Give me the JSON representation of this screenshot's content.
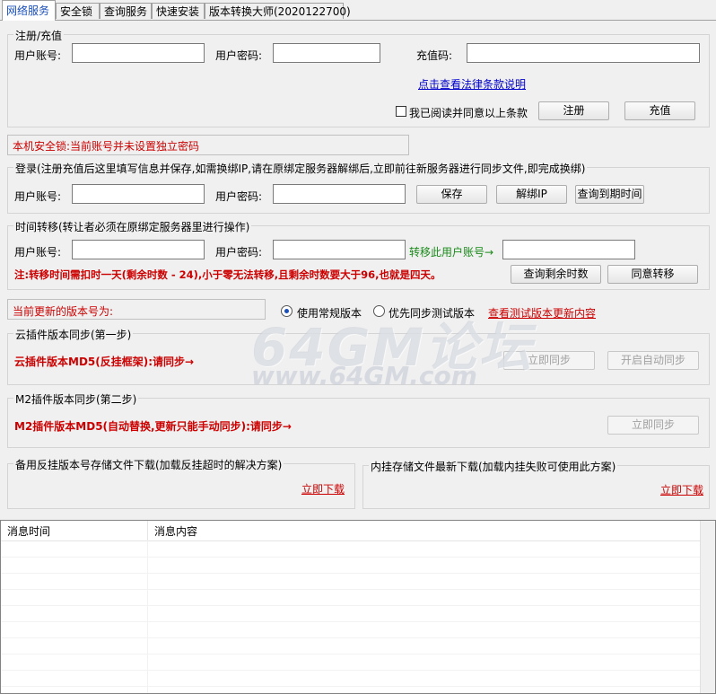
{
  "tabs": [
    {
      "label": "网络服务",
      "active": true
    },
    {
      "label": "安全锁",
      "active": false
    },
    {
      "label": "查询服务",
      "active": false
    },
    {
      "label": "快速安装",
      "active": false
    },
    {
      "label": "版本转换大师(2020122700)",
      "active": false
    }
  ],
  "register": {
    "title": "注册/充值",
    "account_label": "用户账号:",
    "password_label": "用户密码:",
    "recharge_code_label": "充值码:",
    "account_value": "",
    "password_value": "",
    "recharge_code_value": "",
    "legal_link": "点击查看法律条款说明",
    "agree_label": "我已阅读并同意以上条款",
    "agree_checked": false,
    "register_button": "注册",
    "recharge_button": "充值"
  },
  "security_lock_status": "本机安全锁:当前账号并未设置独立密码",
  "login": {
    "title": "登录(注册充值后这里填写信息并保存,如需换绑IP,请在原绑定服务器解绑后,立即前往新服务器进行同步文件,即完成换绑)",
    "account_label": "用户账号:",
    "password_label": "用户密码:",
    "account_value": "",
    "password_value": "",
    "save_button": "保存",
    "unbind_button": "解绑IP",
    "query_expiry_button": "查询到期时间"
  },
  "transfer": {
    "title": "时间转移(转让者必须在原绑定服务器里进行操作)",
    "account_label": "用户账号:",
    "password_label": "用户密码:",
    "target_label": "转移此用户账号→",
    "account_value": "",
    "password_value": "",
    "target_value": "",
    "notice": "注:转移时间需扣时一天(剩余时数 - 24),小于零无法转移,且剩余时数要大于96,也就是四天。",
    "query_remaining_button": "查询剩余时数",
    "agree_transfer_button": "同意转移"
  },
  "version": {
    "current_label": "当前更新的版本号为:",
    "radio_normal": "使用常规版本",
    "radio_test": "优先同步测试版本",
    "radio_normal_checked": true,
    "view_test_link": "查看测试版本更新内容"
  },
  "cloud_sync": {
    "title": "云插件版本同步(第一步)",
    "md5_text": "云插件版本MD5(反挂框架):请同步→",
    "sync_button": "立即同步",
    "auto_sync_button": "开启自动同步"
  },
  "m2_sync": {
    "title": "M2插件版本同步(第二步)",
    "md5_text": "M2插件版本MD5(自动替换,更新只能手动同步):请同步→",
    "sync_button": "立即同步"
  },
  "backup_download": {
    "title": "备用反挂版本号存储文件下载(加载反挂超时的解决方案)",
    "link": "立即下载"
  },
  "inner_download": {
    "title": "内挂存储文件最新下载(加载内挂失败可使用此方案)",
    "link": "立即下载"
  },
  "log_table": {
    "columns": [
      "消息时间",
      "消息内容"
    ],
    "rows": []
  },
  "watermark": {
    "main": "64GM论坛",
    "sub": "www.64GM.com"
  },
  "colors": {
    "accent": "#1a4fb8",
    "warning_red": "#cc0000",
    "ok_green": "#1a8a1a",
    "link_blue": "#0000cc"
  }
}
